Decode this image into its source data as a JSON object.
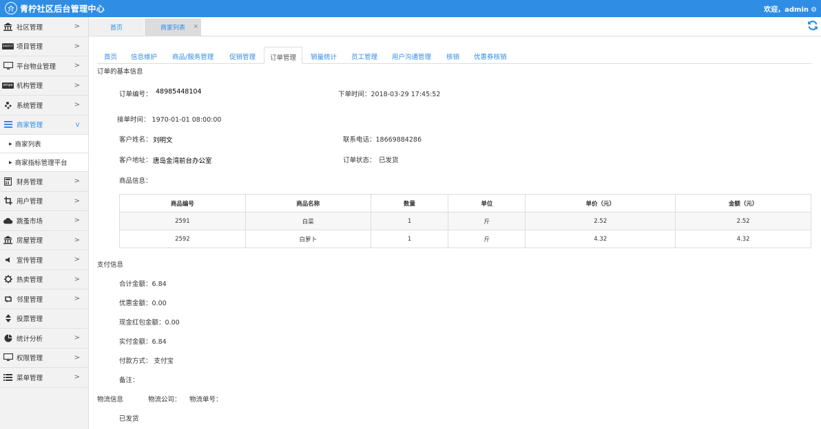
{
  "header": {
    "logo_glyph": "介",
    "title": "青柠社区后台管理中心",
    "welcome": "欢迎，admin",
    "gear_glyph": "⚙"
  },
  "sidebar": {
    "items": [
      {
        "label": "社区管理",
        "icon": "bank-icon"
      },
      {
        "label": "项目管理",
        "icon": "project-icon"
      },
      {
        "label": "平台物业管理",
        "icon": "monitor-icon"
      },
      {
        "label": "机构管理",
        "icon": "stripe-icon"
      },
      {
        "label": "系统管理",
        "icon": "yelp-icon"
      },
      {
        "label": "商家管理",
        "icon": "list-icon"
      },
      {
        "label": "财务管理",
        "icon": "calculator-icon"
      },
      {
        "label": "用户管理",
        "icon": "crop-icon"
      },
      {
        "label": "跳蚤市场",
        "icon": "cloud-icon"
      },
      {
        "label": "房屋管理",
        "icon": "bank-icon"
      },
      {
        "label": "宣传管理",
        "icon": "volume-icon"
      },
      {
        "label": "热卖管理",
        "icon": "gear-icon"
      },
      {
        "label": "邻里管理",
        "icon": "retweet-icon"
      },
      {
        "label": "投票管理",
        "icon": "sort-icon"
      },
      {
        "label": "统计分析",
        "icon": "pie-chart-icon"
      },
      {
        "label": "权限管理",
        "icon": "desktop-icon"
      },
      {
        "label": "菜单管理",
        "icon": "list-icon"
      }
    ],
    "sub_items": [
      "商家列表",
      "商家指标管理平台"
    ],
    "stripe_text": "stripe",
    "project_text": "INKSPOT"
  },
  "tabs": {
    "home": "首页",
    "merchant_list": "商家列表",
    "close": "×"
  },
  "nav": [
    "首页",
    "信息维护",
    "商品/服务管理",
    "促销管理",
    "订单管理",
    "销量统计",
    "员工管理",
    "用户沟通管理",
    "核销",
    "优惠券核销"
  ],
  "order": {
    "section_title": "订单的基本信息",
    "order_no_label": "订单编号：",
    "order_no": "48985448104",
    "order_time": "下单时间：2018-03-29 17:45:52",
    "accept_time": "接单时间： 1970-01-01 08:00:00",
    "customer_name_label": "客户姓名：",
    "customer_name": "刘明文",
    "phone": "联系电话：18669884286",
    "address_label": "客户地址：",
    "address": "唐岛金湾前台办公室",
    "status_label": "订单状态：",
    "status": "已发货",
    "goods_label": "商品信息："
  },
  "goods_table": {
    "headers": [
      "商品编号",
      "商品名称",
      "数量",
      "单位",
      "单价（元）",
      "金额（元）"
    ],
    "rows": [
      [
        "2591",
        "白菜",
        "1",
        "斤",
        "2.52",
        "2.52"
      ],
      [
        "2592",
        "白萝卜",
        "1",
        "斤",
        "4.32",
        "4.32"
      ]
    ]
  },
  "payment": {
    "section_title": "支付信息",
    "total": "合计金额：6.84",
    "discount": "优惠金额：0.00",
    "cash_redpack": "现金红包金额：0.00",
    "paid": "实付金额：6.84",
    "method": "付款方式： 支付宝",
    "remark": "备注："
  },
  "logistics": {
    "section_title": "物流信息",
    "company": "物流公司：",
    "tracking": "物流单号：",
    "status": "已发货"
  },
  "colors": {
    "accent": "#2f8de4"
  }
}
